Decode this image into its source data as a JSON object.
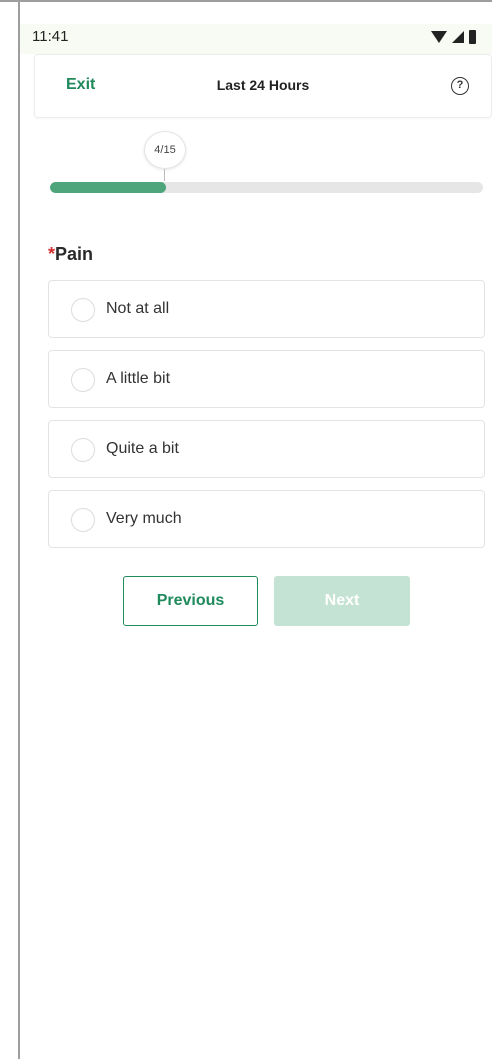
{
  "status_bar": {
    "time": "11:41",
    "icons": [
      "wifi-icon",
      "signal-icon",
      "battery-icon"
    ]
  },
  "header": {
    "exit_label": "Exit",
    "title": "Last 24 Hours",
    "help_symbol": "?"
  },
  "progress": {
    "label": "4/15",
    "current": 4,
    "total": 15,
    "fraction": 0.267
  },
  "question": {
    "required_marker": "*",
    "label": "Pain",
    "options": [
      {
        "label": "Not at all",
        "selected": false
      },
      {
        "label": "A little bit",
        "selected": false
      },
      {
        "label": "Quite a bit",
        "selected": false
      },
      {
        "label": "Very much",
        "selected": false
      }
    ]
  },
  "buttons": {
    "previous_label": "Previous",
    "next_label": "Next",
    "next_enabled": false
  },
  "colors": {
    "accent": "#1f8a5b",
    "progress_fill": "#4ea57c",
    "disabled_button": "#c4e3d4",
    "required": "#d32f2f"
  }
}
